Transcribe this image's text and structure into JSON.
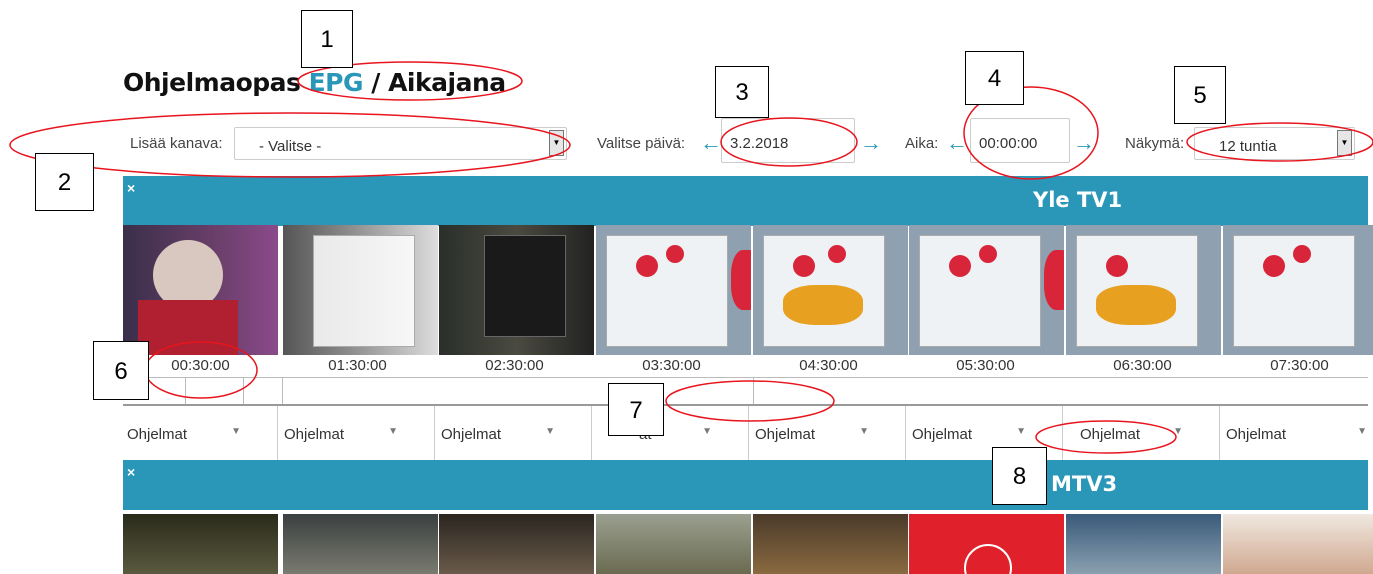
{
  "page_title": {
    "prefix": "Ohjelmaopas",
    "epg": "EPG",
    "suffix": "/ Aikajana"
  },
  "controls": {
    "add_channel_label": "Lisää kanava:",
    "add_channel_value": "- Valitse -",
    "date_label": "Valitse päivä:",
    "date_value": "3.2.2018",
    "time_label": "Aika:",
    "time_value": "00:00:00",
    "view_label": "Näkymä:",
    "view_value": "12 tuntia"
  },
  "channels": [
    {
      "close": "×",
      "name": "Yle TV1"
    },
    {
      "close": "×",
      "name": "MTV3"
    }
  ],
  "timeline": [
    "00:30:00",
    "01:30:00",
    "02:30:00",
    "03:30:00",
    "04:30:00",
    "05:30:00",
    "06:30:00",
    "07:30:00"
  ],
  "program_dropdowns": [
    "Ohjelmat",
    "Ohjelmat",
    "Ohjelmat",
    "at",
    "Ohjelmat",
    "Ohjelmat",
    "Ohjelmat",
    "Ohjelmat"
  ],
  "callouts": [
    "1",
    "2",
    "3",
    "4",
    "5",
    "6",
    "7",
    "8"
  ],
  "colors": {
    "accent": "#2b97b8",
    "annotation_red": "#e8141e"
  }
}
